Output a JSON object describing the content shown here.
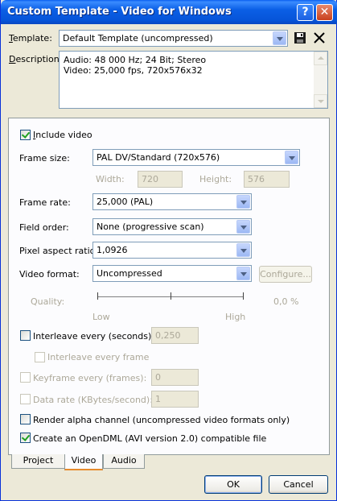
{
  "window": {
    "title": "Custom Template - Video for Windows",
    "help_glyph": "?",
    "close_glyph": "✕"
  },
  "template": {
    "label_prefix": "T",
    "label_rest": "emplate:",
    "value": "Default Template (uncompressed)"
  },
  "description": {
    "label_prefix": "D",
    "label_rest": "escription:",
    "lines": [
      "Audio: 48 000 Hz; 24 Bit; Stereo",
      "Video: 25,000 fps, 720x576x32"
    ]
  },
  "video": {
    "include_video": {
      "label_prefix": "I",
      "label_rest": "nclude video",
      "checked": true
    },
    "frame_size": {
      "label": "Frame size:",
      "value": "PAL DV/Standard (720x576)"
    },
    "width": {
      "label": "Width:",
      "value": "720"
    },
    "height": {
      "label": "Height:",
      "value": "576"
    },
    "frame_rate": {
      "label": "Frame rate:",
      "value": "25,000 (PAL)"
    },
    "field_order": {
      "label": "Field order:",
      "value": "None (progressive scan)"
    },
    "pixel_aspect": {
      "label": "Pixel aspect ratio:",
      "value": "1,0926"
    },
    "video_format": {
      "label": "Video format:",
      "value": "Uncompressed",
      "configure": "Configure..."
    },
    "quality": {
      "label": "Quality:",
      "value": "0,0 %",
      "low": "Low",
      "high": "High"
    },
    "interleave_every": {
      "label": "Interleave every (seconds):",
      "value": "0,250",
      "checked": false
    },
    "interleave_every_frame": {
      "label": "Interleave every frame",
      "checked": false
    },
    "keyframe_every": {
      "label": "Keyframe every (frames):",
      "value": "0",
      "checked": false
    },
    "data_rate": {
      "label": "Data rate (KBytes/second):",
      "value": "1",
      "checked": false
    },
    "render_alpha": {
      "label": "Render alpha channel (uncompressed video formats only)",
      "checked": false
    },
    "opendml": {
      "label": "Create an OpenDML (AVI version 2.0) compatible file",
      "checked": true
    }
  },
  "tabs": [
    "Project",
    "Video",
    "Audio"
  ],
  "active_tab": "Video",
  "buttons": {
    "ok": "OK",
    "cancel": "Cancel"
  }
}
